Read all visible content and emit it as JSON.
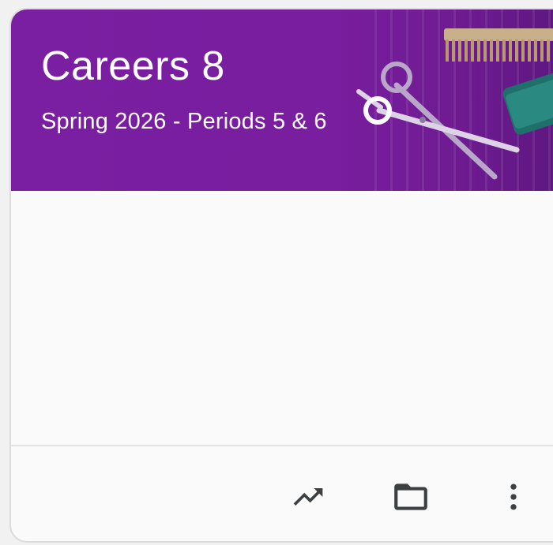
{
  "card": {
    "title": "Careers 8",
    "subtitle": "Spring 2026 - Periods 5 & 6",
    "banner_color": "#7b1fa2",
    "banner_theme_icons": [
      "comb-icon",
      "scissors-icon",
      "thread-spool-icon"
    ]
  },
  "footer": {
    "actions": [
      {
        "icon": "trending-up-icon",
        "label": "Open your work"
      },
      {
        "icon": "folder-icon",
        "label": "Open folder"
      },
      {
        "icon": "more-vert-icon",
        "label": "More options"
      }
    ]
  },
  "colors": {
    "icon": "#3c4043",
    "card_background": "#fafafa",
    "border": "#dcdcdc"
  }
}
